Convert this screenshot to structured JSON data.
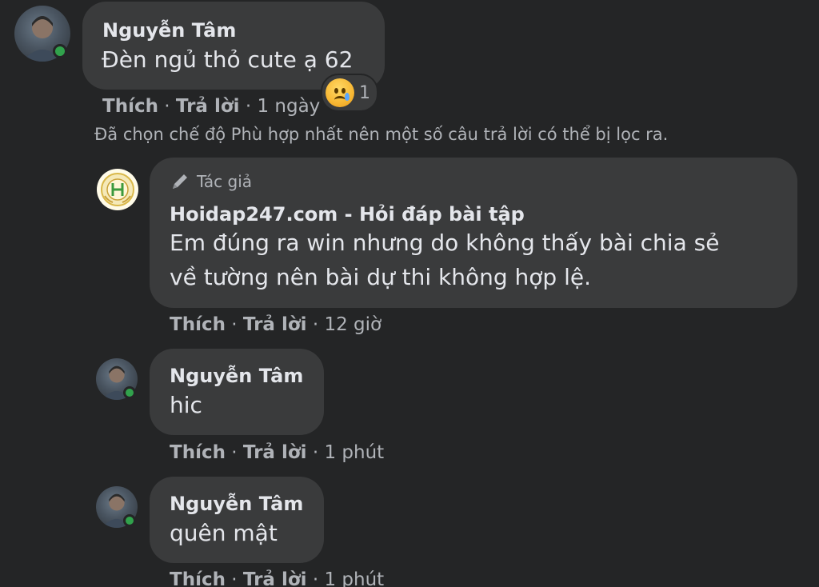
{
  "comments": [
    {
      "author": "Nguyễn Tâm",
      "text": "Đèn ngủ thỏ cute ạ 62",
      "like_label": "Thích",
      "reply_label": "Trả lời",
      "time": "1 ngày",
      "reaction_count": "1",
      "reaction_icon": "sad-crying-emoji"
    }
  ],
  "filter_note": "Đã chọn chế độ Phù hợp nhất nên một số câu trả lời có thể bị lọc ra.",
  "replies": [
    {
      "badge": "Tác giả",
      "badge_icon": "pencil-icon",
      "author": "Hoidap247.com - Hỏi đáp bài tập",
      "text_lines": [
        "Em đúng ra win nhưng do không thấy bài chia sẻ",
        "về tường nên bài dự thi không hợp lệ."
      ],
      "like_label": "Thích",
      "reply_label": "Trả lời",
      "time": "12 giờ"
    },
    {
      "author": "Nguyễn Tâm",
      "text": "hic",
      "like_label": "Thích",
      "reply_label": "Trả lời",
      "time": "1 phút"
    },
    {
      "author": "Nguyễn Tâm",
      "text": "quên mật",
      "like_label": "Thích",
      "reply_label": "Trả lời",
      "time": "1 phút"
    }
  ],
  "colors": {
    "background": "#242526",
    "bubble": "#3a3b3c",
    "primary_text": "#e4e6eb",
    "secondary_text": "#b0b3b8",
    "online": "#31a24c"
  }
}
